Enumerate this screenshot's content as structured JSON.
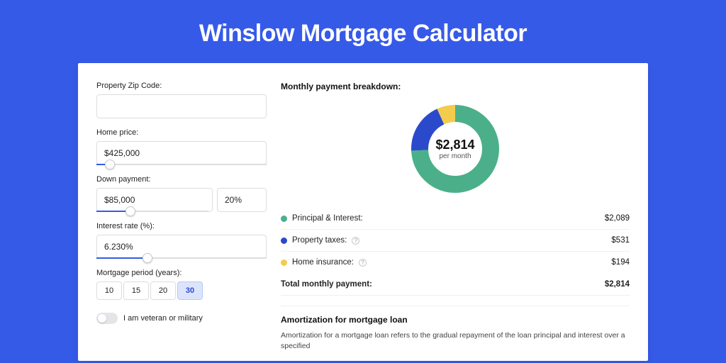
{
  "title": "Winslow Mortgage Calculator",
  "form": {
    "zip": {
      "label": "Property Zip Code:",
      "value": ""
    },
    "home_price": {
      "label": "Home price:",
      "value": "$425,000",
      "slider_pct": 8
    },
    "down_payment": {
      "label": "Down payment:",
      "value": "$85,000",
      "pct_value": "20%",
      "slider_pct": 20
    },
    "interest": {
      "label": "Interest rate (%):",
      "value": "6.230%",
      "slider_pct": 30
    },
    "period": {
      "label": "Mortgage period (years):",
      "options": [
        "10",
        "15",
        "20",
        "30"
      ],
      "selected": "30"
    },
    "veteran": {
      "label": "I am veteran or military",
      "on": false
    }
  },
  "breakdown": {
    "title": "Monthly payment breakdown:",
    "center_amount": "$2,814",
    "center_sub": "per month",
    "items": [
      {
        "label": "Principal & Interest:",
        "value": "$2,089",
        "color": "#4bb08a",
        "help": false
      },
      {
        "label": "Property taxes:",
        "value": "$531",
        "color": "#2b4acb",
        "help": true
      },
      {
        "label": "Home insurance:",
        "value": "$194",
        "color": "#f3cc4e",
        "help": true
      }
    ],
    "total_label": "Total monthly payment:",
    "total_value": "$2,814"
  },
  "chart_data": {
    "type": "pie",
    "title": "Monthly payment breakdown",
    "series": [
      {
        "name": "Principal & Interest",
        "value": 2089,
        "color": "#4bb08a"
      },
      {
        "name": "Property taxes",
        "value": 531,
        "color": "#2b4acb"
      },
      {
        "name": "Home insurance",
        "value": 194,
        "color": "#f3cc4e"
      }
    ],
    "total": 2814
  },
  "amort": {
    "title": "Amortization for mortgage loan",
    "text": "Amortization for a mortgage loan refers to the gradual repayment of the loan principal and interest over a specified"
  }
}
